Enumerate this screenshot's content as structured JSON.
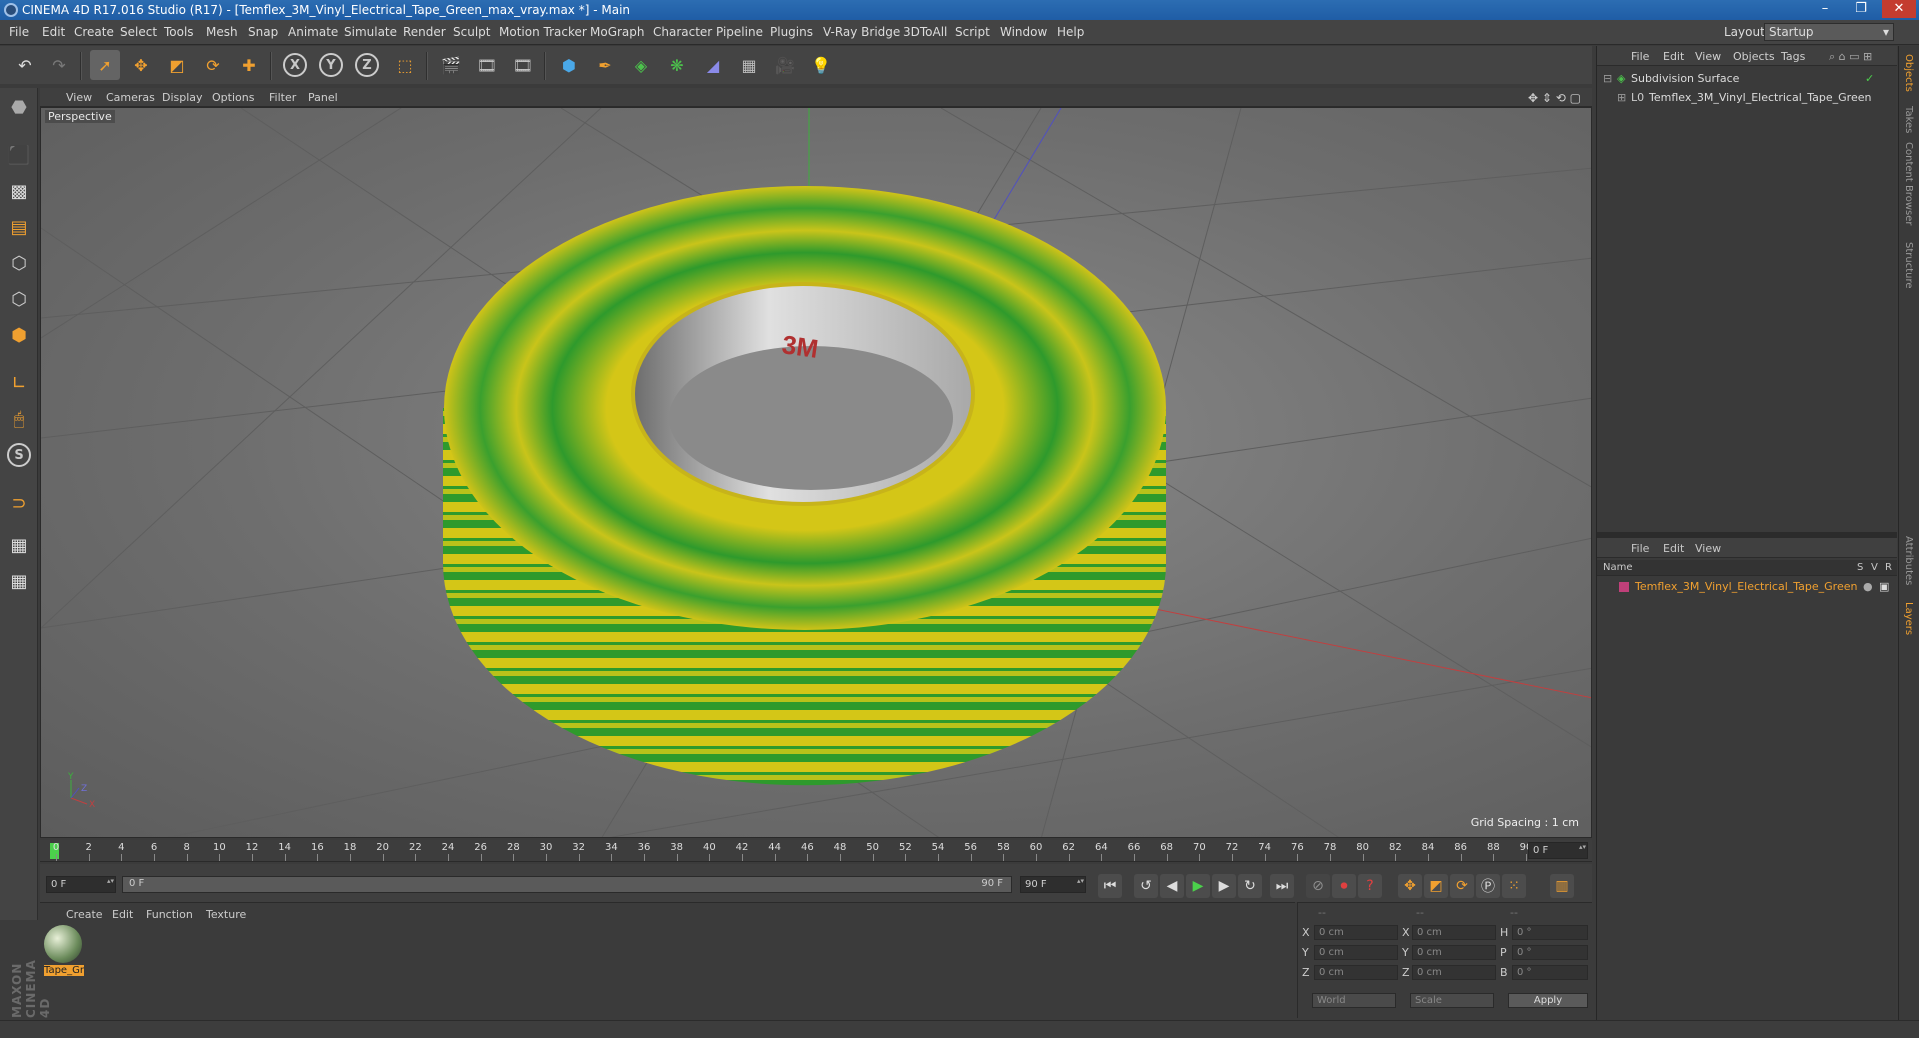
{
  "window": {
    "title": "CINEMA 4D R17.016 Studio (R17) - [Temflex_3M_Vinyl_Electrical_Tape_Green_max_vray.max *] - Main",
    "controls": [
      "–",
      "❐",
      "✕"
    ]
  },
  "menubar": {
    "items": [
      "File",
      "Edit",
      "Create",
      "Select",
      "Tools",
      "Mesh",
      "Snap",
      "Animate",
      "Simulate",
      "Render",
      "Sculpt",
      "Motion Tracker",
      "MoGraph",
      "Character",
      "Pipeline",
      "Plugins",
      "V-Ray Bridge",
      "3DToAll",
      "Script",
      "Window",
      "Help"
    ],
    "layout_label": "Layout:",
    "layout_value": "Startup"
  },
  "viewport": {
    "menu": [
      "View",
      "Cameras",
      "Display",
      "Options",
      "Filter",
      "Panel"
    ],
    "camera_label": "Perspective",
    "grid_spacing": "Grid Spacing : 1 cm",
    "axis_labels": {
      "y": "Y",
      "x": "X",
      "z": "Z"
    },
    "model_colors": {
      "green": "#2e9a2c",
      "yellow": "#d4c617",
      "inner": "#d8d8d8",
      "logo": "#b03030"
    }
  },
  "timeline": {
    "ticks": [
      "0",
      "2",
      "4",
      "6",
      "8",
      "10",
      "12",
      "14",
      "16",
      "18",
      "20",
      "22",
      "24",
      "26",
      "28",
      "30",
      "32",
      "34",
      "36",
      "38",
      "40",
      "42",
      "44",
      "46",
      "48",
      "50",
      "52",
      "54",
      "56",
      "58",
      "60",
      "62",
      "64",
      "66",
      "68",
      "70",
      "72",
      "74",
      "76",
      "78",
      "80",
      "82",
      "84",
      "86",
      "88",
      "90"
    ],
    "current_frame": "0 F"
  },
  "transport": {
    "start_field": "0 F",
    "range_start": "0 F",
    "range_end": "90 F",
    "end_field": "90 F"
  },
  "material_panel": {
    "menu": [
      "Create",
      "Edit",
      "Function",
      "Texture"
    ],
    "material_name": "Tape_Gr"
  },
  "coordinates": {
    "header": [
      "--",
      "--",
      "--"
    ],
    "rows": [
      {
        "l1": "X",
        "v1": "0 cm",
        "l2": "X",
        "v2": "0 cm",
        "l3": "H",
        "v3": "0 °"
      },
      {
        "l1": "Y",
        "v1": "0 cm",
        "l2": "Y",
        "v2": "0 cm",
        "l3": "P",
        "v3": "0 °"
      },
      {
        "l1": "Z",
        "v1": "0 cm",
        "l2": "Z",
        "v2": "0 cm",
        "l3": "B",
        "v3": "0 °"
      }
    ],
    "space_select": "World",
    "mode_select": "Scale",
    "apply_label": "Apply"
  },
  "object_manager": {
    "menu": [
      "File",
      "Edit",
      "View",
      "Objects",
      "Tags"
    ],
    "objects": [
      {
        "name": "Subdivision Surface"
      },
      {
        "name": "Temflex_3M_Vinyl_Electrical_Tape_Green"
      }
    ]
  },
  "layer_manager": {
    "menu": [
      "File",
      "Edit",
      "View"
    ],
    "columns": {
      "name": "Name",
      "s": "S",
      "v": "V",
      "r": "R"
    },
    "layers": [
      {
        "name": "Temflex_3M_Vinyl_Electrical_Tape_Green"
      }
    ]
  },
  "side_tabs": [
    "Objects",
    "Takes",
    "Content Browser",
    "Structure",
    "Attributes",
    "Layers"
  ],
  "branding": "MAXON CINEMA 4D"
}
